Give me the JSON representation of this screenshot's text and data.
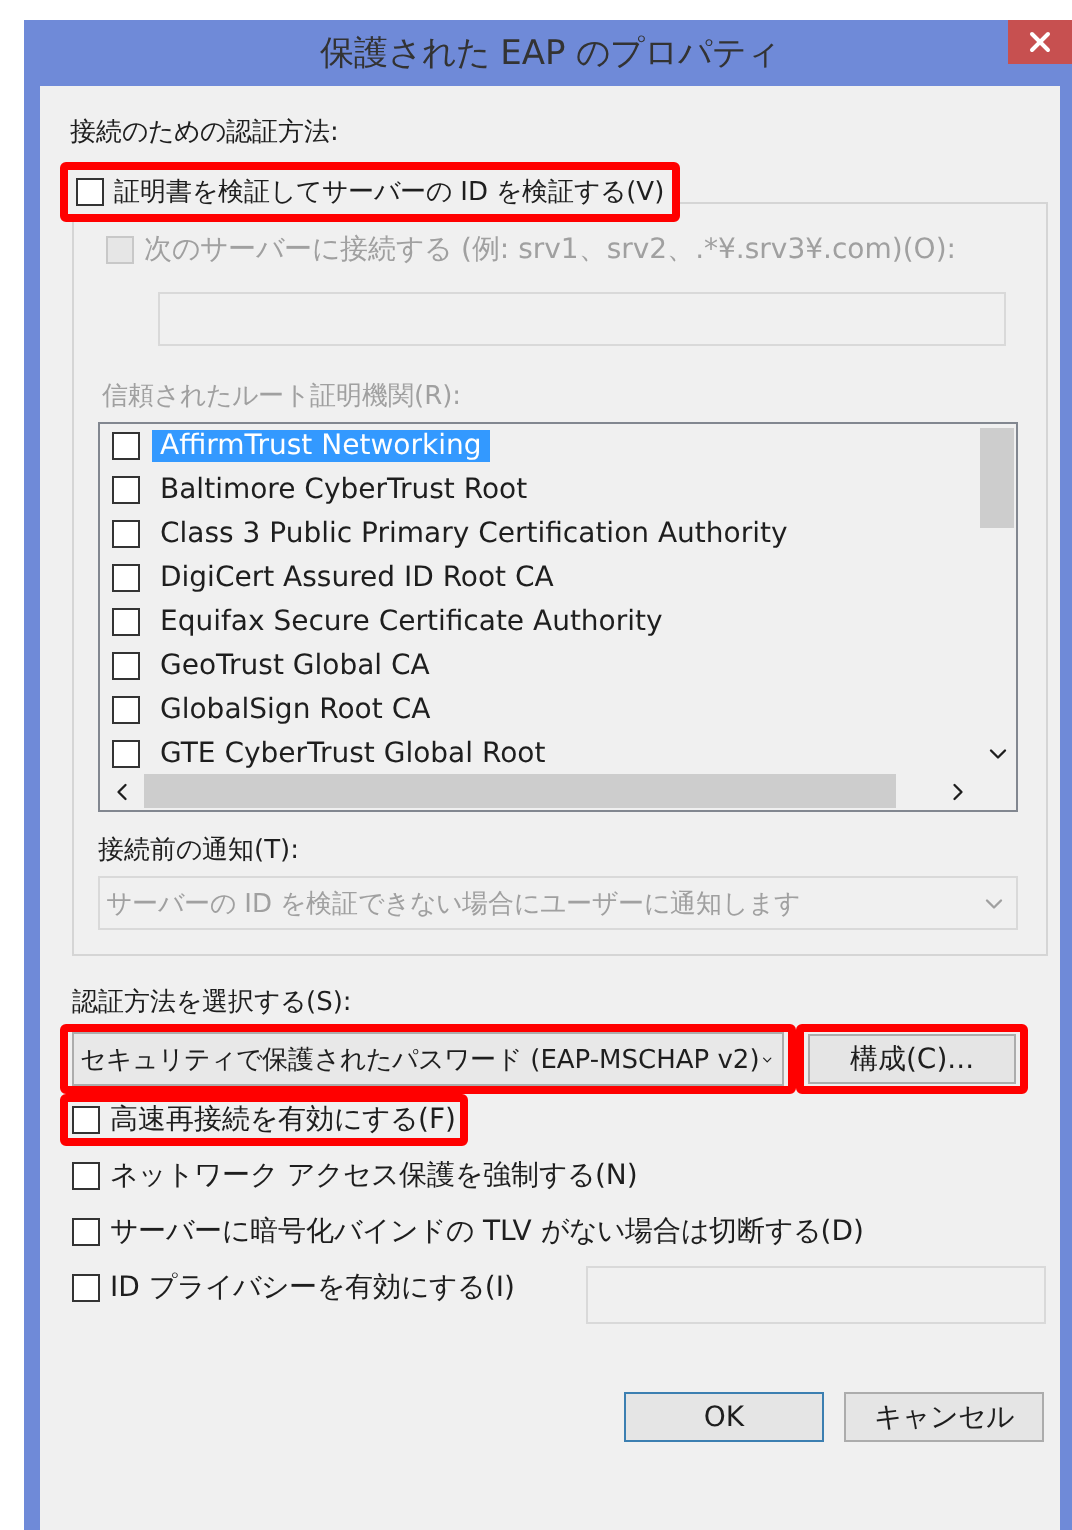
{
  "window": {
    "title": "保護された EAP のプロパティ"
  },
  "auth_label": "接続のための認証方法:",
  "verify_certificate": {
    "label": "証明書を検証してサーバーの ID を検証する(V)",
    "checked": false,
    "highlighted": true
  },
  "connect_to_servers": {
    "label": "次のサーバーに接続する (例: srv1、srv2、.*¥.srv3¥.com)(O):",
    "checked": false,
    "disabled": true
  },
  "trusted_roots": {
    "label": "信頼されたルート証明機関(R):",
    "disabled": true,
    "items": [
      {
        "name": "AffirmTrust Networking",
        "checked": false,
        "selected": true
      },
      {
        "name": "Baltimore CyberTrust Root",
        "checked": false,
        "selected": false
      },
      {
        "name": "Class 3 Public Primary Certification Authority",
        "checked": false,
        "selected": false
      },
      {
        "name": "DigiCert Assured ID Root CA",
        "checked": false,
        "selected": false
      },
      {
        "name": "Equifax Secure Certificate Authority",
        "checked": false,
        "selected": false
      },
      {
        "name": "GeoTrust Global CA",
        "checked": false,
        "selected": false
      },
      {
        "name": "GlobalSign Root CA",
        "checked": false,
        "selected": false
      },
      {
        "name": "GTE CyberTrust Global Root",
        "checked": false,
        "selected": false
      }
    ]
  },
  "notification": {
    "label": "接続前の通知(T):",
    "value": "サーバーの ID を検証できない場合にユーザーに通知します",
    "disabled": true
  },
  "method": {
    "label": "認証方法を選択する(S):",
    "value": "セキュリティで保護されたパスワード (EAP-MSCHAP v2)",
    "highlighted": true
  },
  "configure_button": {
    "label": "構成(C)...",
    "highlighted": true
  },
  "options": [
    {
      "kind": "plain",
      "label": "高速再接続を有効にする(F)",
      "checked": false,
      "highlighted": true
    },
    {
      "kind": "plain",
      "label": "ネットワーク アクセス保護を強制する(N)",
      "checked": false,
      "highlighted": false
    },
    {
      "kind": "plain",
      "label": "サーバーに暗号化バインドの TLV がない場合は切断する(D)",
      "checked": false,
      "highlighted": false
    },
    {
      "kind": "with_field",
      "label": "ID プライバシーを有効にする(I)",
      "checked": false,
      "highlighted": false
    }
  ],
  "buttons": [
    {
      "label": "OK",
      "default": true
    },
    {
      "label": "キャンセル",
      "default": false
    }
  ]
}
